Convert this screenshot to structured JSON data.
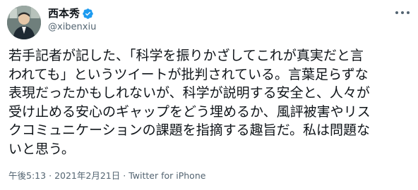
{
  "tweet": {
    "display_name": "西本秀",
    "handle": "@xibenxiu",
    "text_lines": [
      "若手記者が記した、「科学を振りかざしてこれが真実だと言",
      "われても」というツイートが批判されている。言葉足らずな",
      "表現だったかもしれないが、科学が説明する安全と、人々が",
      "受け止める安心のギャップをどう埋めるか、風評被害やリス",
      "クコミュニケーションの課題を指摘する趣旨だ。私は問題な",
      "いと思う。"
    ],
    "time": "午後5:13",
    "separator": "·",
    "date": "2021年2月21日",
    "source": "Twitter for iPhone"
  },
  "colors": {
    "verified_badge": "#1d9bf0",
    "secondary_text": "#536471",
    "primary_text": "#0f1419"
  },
  "icons": {
    "verified": "verified-badge-icon",
    "more": "more-options-icon"
  }
}
